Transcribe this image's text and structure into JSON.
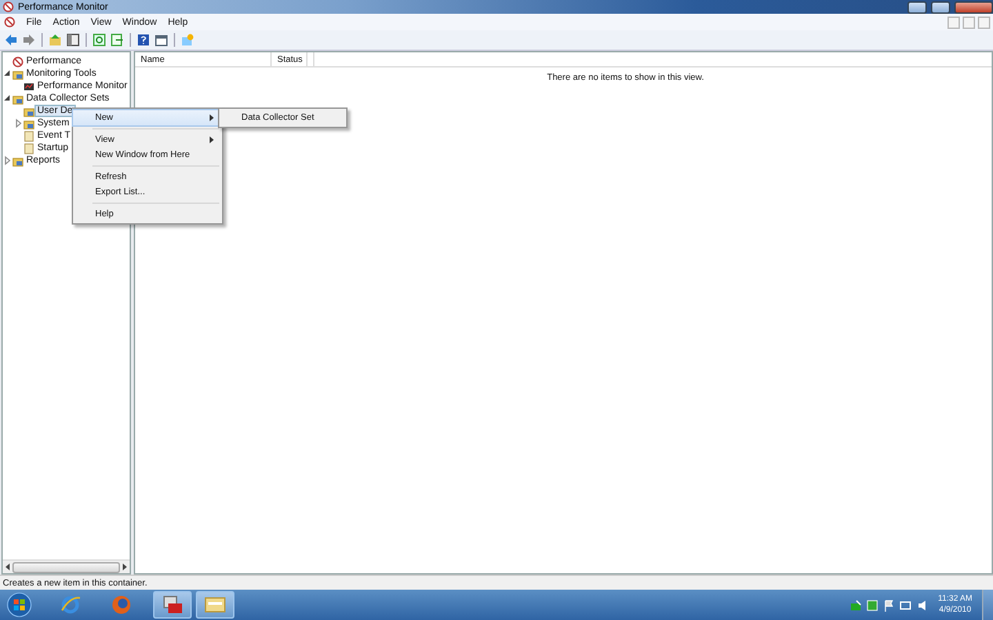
{
  "window": {
    "title": "Performance Monitor"
  },
  "menu_bar": [
    "File",
    "Action",
    "View",
    "Window",
    "Help"
  ],
  "tree": [
    {
      "label": "Performance",
      "selected": false
    },
    {
      "label": "Monitoring Tools",
      "expanded": true,
      "selected": false,
      "children": [
        {
          "label": "Performance Monitor",
          "selected": false
        }
      ]
    },
    {
      "label": "Data Collector Sets",
      "expanded": true,
      "selected": false,
      "children": [
        {
          "label": "User De",
          "selected": true
        },
        {
          "label": "System",
          "expanded": false,
          "selected": false
        },
        {
          "label": "Event T",
          "selected": false
        },
        {
          "label": "Startup",
          "selected": false
        }
      ]
    },
    {
      "label": "Reports",
      "expanded": false,
      "selected": false
    }
  ],
  "table": {
    "columns": [
      "Name",
      "Status"
    ],
    "empty_message": "There are no items to show in this view."
  },
  "context_menu": [
    [
      {
        "label": "New",
        "submenu": true,
        "selected": true
      }
    ],
    [
      {
        "label": "View",
        "submenu": true,
        "selected": false
      },
      {
        "label": "New Window from Here",
        "submenu": false,
        "selected": false
      }
    ],
    [
      {
        "label": "Refresh",
        "submenu": false,
        "selected": false
      },
      {
        "label": "Export List...",
        "submenu": false,
        "selected": false
      }
    ],
    [
      {
        "label": "Help",
        "submenu": false,
        "selected": false
      }
    ]
  ],
  "submenu": [
    {
      "label": "Data Collector Set",
      "selected": false
    }
  ],
  "status_bar": "Creates a new item in this container.",
  "taskbar": {
    "apps": [
      {
        "active": false
      },
      {
        "active": false
      },
      {
        "active": true
      },
      {
        "active": true
      }
    ],
    "time": "11:32 AM",
    "date": "4/9/2010"
  }
}
